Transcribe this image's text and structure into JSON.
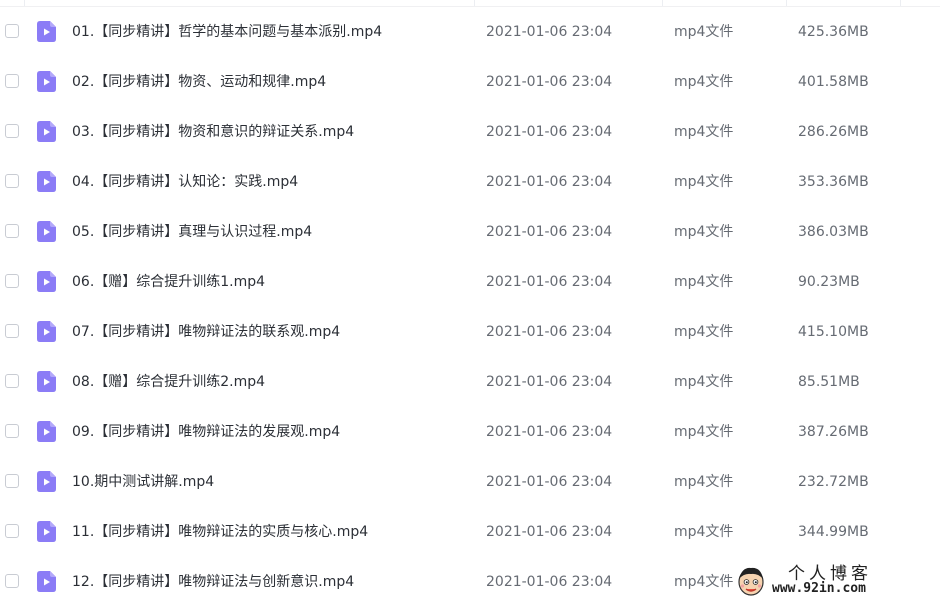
{
  "files": [
    {
      "name": "01.【同步精讲】哲学的基本问题与基本派别.mp4",
      "date": "2021-01-06 23:04",
      "type": "mp4文件",
      "size": "425.36MB"
    },
    {
      "name": "02.【同步精讲】物资、运动和规律.mp4",
      "date": "2021-01-06 23:04",
      "type": "mp4文件",
      "size": "401.58MB"
    },
    {
      "name": "03.【同步精讲】物资和意识的辩证关系.mp4",
      "date": "2021-01-06 23:04",
      "type": "mp4文件",
      "size": "286.26MB"
    },
    {
      "name": "04.【同步精讲】认知论：实践.mp4",
      "date": "2021-01-06 23:04",
      "type": "mp4文件",
      "size": "353.36MB"
    },
    {
      "name": "05.【同步精讲】真理与认识过程.mp4",
      "date": "2021-01-06 23:04",
      "type": "mp4文件",
      "size": "386.03MB"
    },
    {
      "name": "06.【赠】综合提升训练1.mp4",
      "date": "2021-01-06 23:04",
      "type": "mp4文件",
      "size": "90.23MB"
    },
    {
      "name": "07.【同步精讲】唯物辩证法的联系观.mp4",
      "date": "2021-01-06 23:04",
      "type": "mp4文件",
      "size": "415.10MB"
    },
    {
      "name": "08.【赠】综合提升训练2.mp4",
      "date": "2021-01-06 23:04",
      "type": "mp4文件",
      "size": "85.51MB"
    },
    {
      "name": "09.【同步精讲】唯物辩证法的发展观.mp4",
      "date": "2021-01-06 23:04",
      "type": "mp4文件",
      "size": "387.26MB"
    },
    {
      "name": "10.期中测试讲解.mp4",
      "date": "2021-01-06 23:04",
      "type": "mp4文件",
      "size": "232.72MB"
    },
    {
      "name": "11.【同步精讲】唯物辩证法的实质与核心.mp4",
      "date": "2021-01-06 23:04",
      "type": "mp4文件",
      "size": "344.99MB"
    },
    {
      "name": "12.【同步精讲】唯物辩证法与创新意识.mp4",
      "date": "2021-01-06 23:04",
      "type": "mp4文件",
      "size": ""
    }
  ],
  "watermark": {
    "title": "个人博客",
    "url": "www.92in.com"
  },
  "colors": {
    "file_icon": "#8b7cf6",
    "play_triangle": "#ffffff"
  },
  "icons": {
    "file": "video-file-icon",
    "checkbox": "checkbox-icon"
  }
}
